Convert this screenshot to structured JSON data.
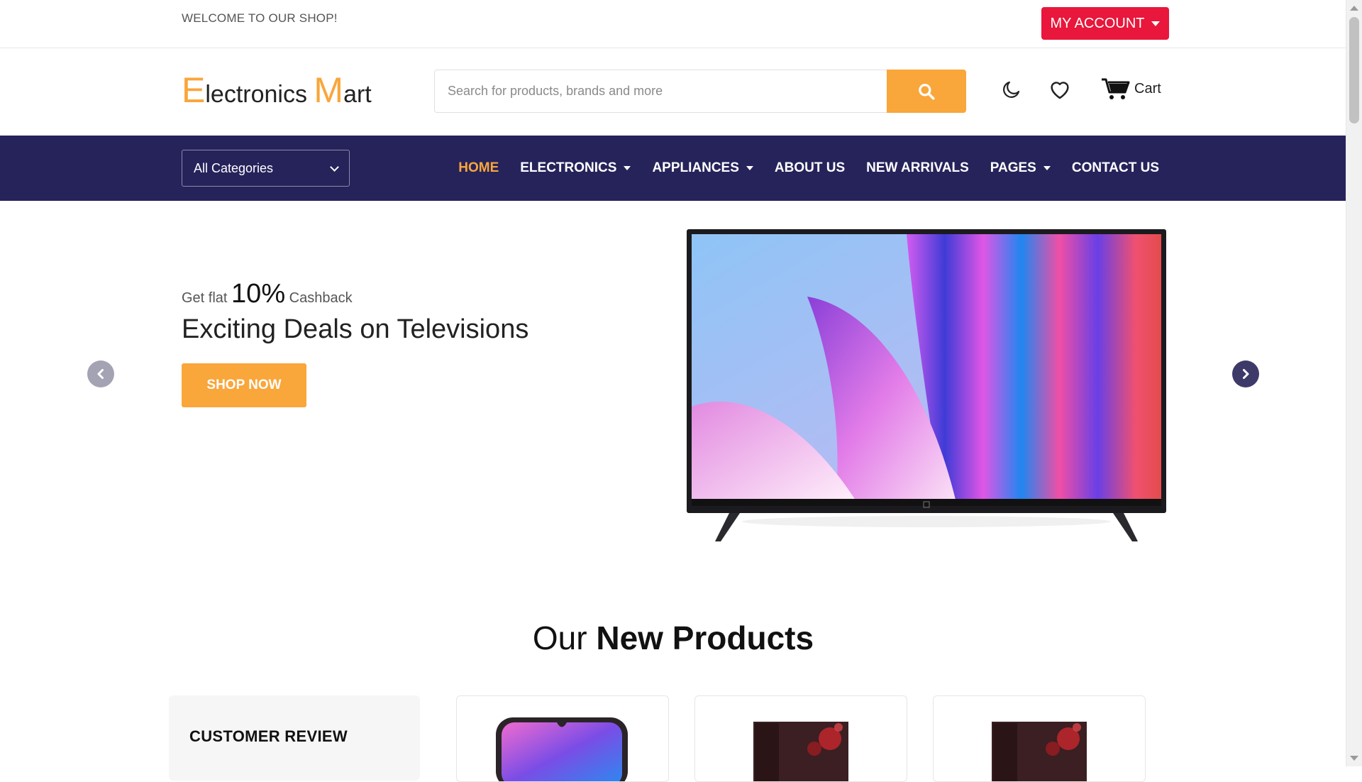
{
  "topbar": {
    "welcome": "WELCOME TO OUR SHOP!",
    "account_label": "MY ACCOUNT"
  },
  "header": {
    "logo": {
      "first_letter": "E",
      "first_rest": "lectronics ",
      "second_letter": "M",
      "second_rest": "art"
    },
    "search_placeholder": "Search for products, brands and more",
    "cart_label": "Cart",
    "icons": [
      "moon-icon",
      "heart-icon",
      "cart-icon",
      "search-icon"
    ]
  },
  "nav": {
    "category_selected": "All Categories",
    "items": [
      {
        "label": "HOME",
        "active": true,
        "dropdown": false
      },
      {
        "label": "ELECTRONICS",
        "active": false,
        "dropdown": true
      },
      {
        "label": "APPLIANCES",
        "active": false,
        "dropdown": true
      },
      {
        "label": "ABOUT US",
        "active": false,
        "dropdown": false
      },
      {
        "label": "NEW ARRIVALS",
        "active": false,
        "dropdown": false
      },
      {
        "label": "PAGES",
        "active": false,
        "dropdown": true
      },
      {
        "label": "CONTACT US",
        "active": false,
        "dropdown": false
      }
    ]
  },
  "hero": {
    "promo_prefix": "Get flat",
    "promo_value": "10%",
    "promo_suffix": "Cashback",
    "title": "Exciting Deals on Televisions",
    "button": "SHOP NOW"
  },
  "new_products": {
    "title_light": "Our ",
    "title_bold": "New Products",
    "review_title": "CUSTOMER REVIEW"
  },
  "colors": {
    "accent": "#f9a63b",
    "nav_bg": "#26235b",
    "account_btn": "#e8173b"
  }
}
